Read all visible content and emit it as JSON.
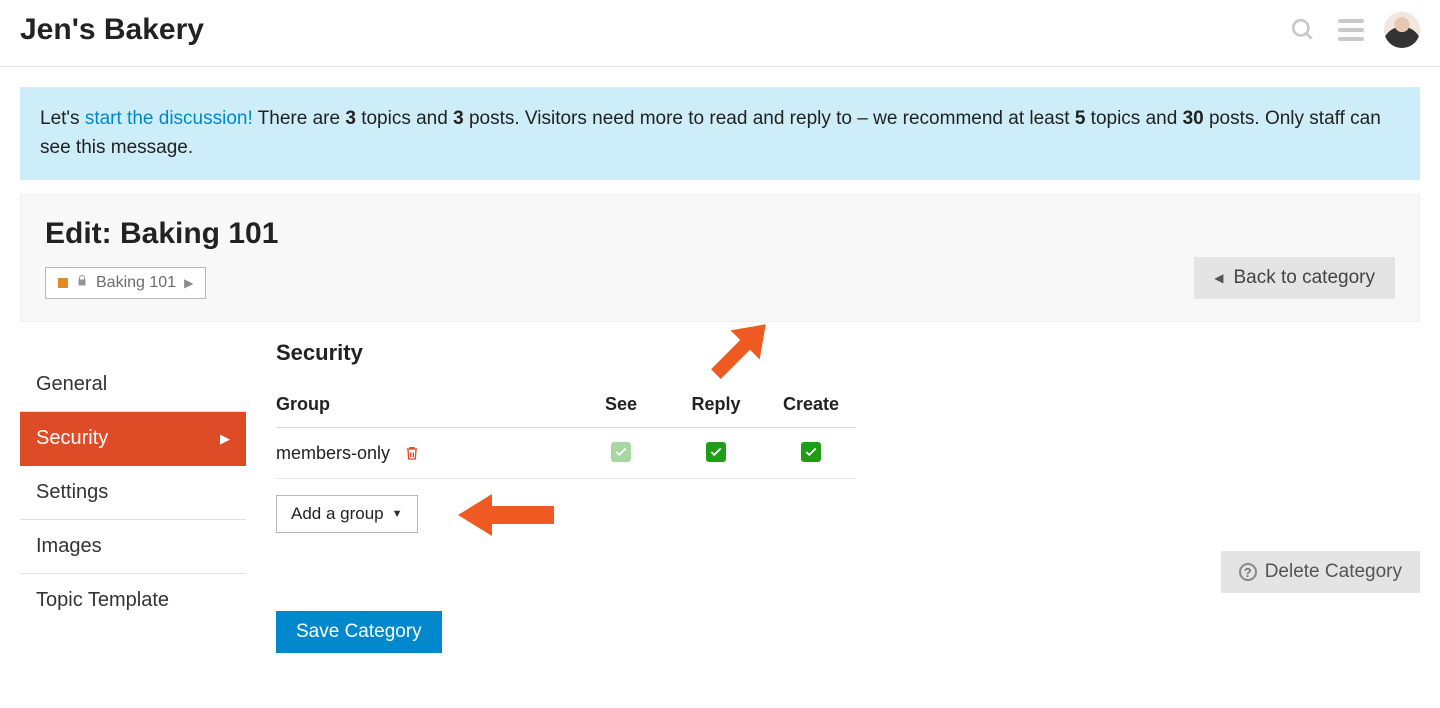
{
  "header": {
    "site_title": "Jen's Bakery"
  },
  "banner": {
    "pre": "Let's ",
    "link": "start the discussion!",
    "mid1": " There are ",
    "topics": "3",
    "mid2": " topics and ",
    "posts": "3",
    "mid3": " posts. Visitors need more to read and reply to – we recommend at least ",
    "rec_topics": "5",
    "mid4": " topics and ",
    "rec_posts": "30",
    "end": " posts. Only staff can see this message."
  },
  "panel": {
    "title": "Edit: Baking 101",
    "crumb_label": "Baking 101",
    "back_label": "Back to category"
  },
  "sidebar": {
    "items": [
      {
        "label": "General"
      },
      {
        "label": "Security"
      },
      {
        "label": "Settings"
      },
      {
        "label": "Images"
      },
      {
        "label": "Topic Template"
      }
    ],
    "active_index": 1
  },
  "security": {
    "title": "Security",
    "columns": {
      "group": "Group",
      "see": "See",
      "reply": "Reply",
      "create": "Create"
    },
    "rows": [
      {
        "name": "members-only",
        "see": true,
        "see_locked": true,
        "reply": true,
        "create": true
      }
    ],
    "add_group_label": "Add a group"
  },
  "actions": {
    "save": "Save Category",
    "delete": "Delete Category"
  }
}
